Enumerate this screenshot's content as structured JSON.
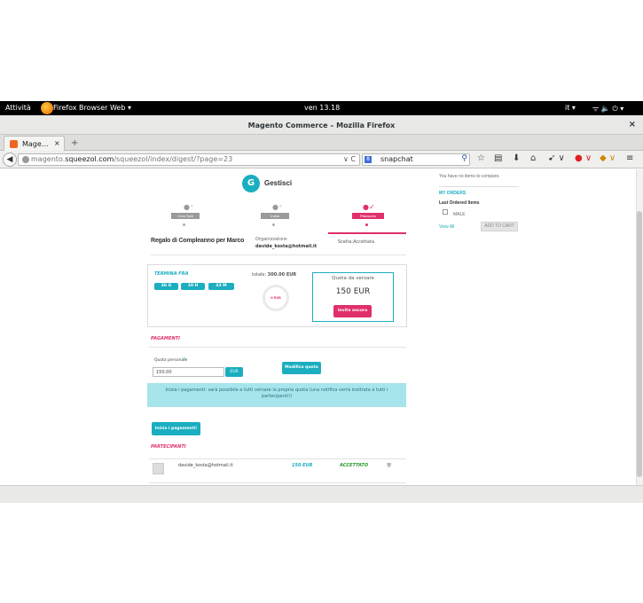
{
  "topbar": {
    "activities": "Attività",
    "app_menu": "Firefox Browser Web ▾",
    "clock": "ven 13.18",
    "lang": "it ▾",
    "tray": "ᯤ  🔈  ⏻ ▾"
  },
  "window": {
    "title": "Magento Commerce – Mozilla Firefox",
    "close": "×"
  },
  "tab": {
    "label": "Mage…",
    "close": "×",
    "new": "+"
  },
  "nav": {
    "back": "◀",
    "url_host_prefix": "magento.",
    "url_host": "squeezol.com",
    "url_path": "/squeezol/index/digest/?page=23",
    "url_right": "∨ C",
    "search_engine": "8",
    "search_query": "snapchat",
    "icons": [
      "☆",
      "▤",
      "⬇",
      "⌂",
      "➹ ∨",
      "● ∨",
      "◆ ∨",
      "≡"
    ]
  },
  "brand": {
    "name": "Gestisci",
    "logo_glyph": "G"
  },
  "steps": [
    {
      "label": "Crea Split",
      "active": false
    },
    {
      "label": "Invita",
      "active": false
    },
    {
      "label": "Riassunto",
      "active": true
    }
  ],
  "event": {
    "title": "Regalo di Compleanno per Marco",
    "organizer_label": "Organizzatore:",
    "organizer_email": "davide_kosta@hotmail.it",
    "choice": "Scelta:Accettata"
  },
  "summary": {
    "ends_label": "TERMINA FRA",
    "countdown": [
      "26 G",
      "10 H",
      "43 M"
    ],
    "total_label": "totale:",
    "total_value": "300.00 EUR",
    "gauge_value": "0 EUR",
    "quota_label": "Quota da versare",
    "quota_value": "150 EUR",
    "invite_button": "Invita ancora"
  },
  "payments": {
    "heading": "PAGAMENTI",
    "personal_label": "Quota personale",
    "info_glyph": "i",
    "input_value": "150.00",
    "currency": "EUR",
    "modify_button": "Modifica quota",
    "notice": "Inizia i pagamenti: sarà possibile a tutti versare la propria quota (una notifica verrà inoltrata a tutti i partecipanti!)",
    "start_button": "Inizia i pagamenti!"
  },
  "participants": {
    "heading": "PARTECIPANTI",
    "rows": [
      {
        "email": "davide_kosta@hotmail.it",
        "amount": "150 EUR",
        "status": "ACCETTATO"
      }
    ]
  },
  "sidebar": {
    "compare_text": "You have no items to compare.",
    "orders_heading": "MY ORDERS",
    "last_ordered": "Last Ordered Items",
    "item_name": "MALE",
    "view_all": "View All",
    "add_to_cart": "ADD TO CART"
  },
  "colors": {
    "accent_pink": "#e0306a",
    "accent_teal": "#1aaec0",
    "status_green": "#2a9a2a"
  }
}
